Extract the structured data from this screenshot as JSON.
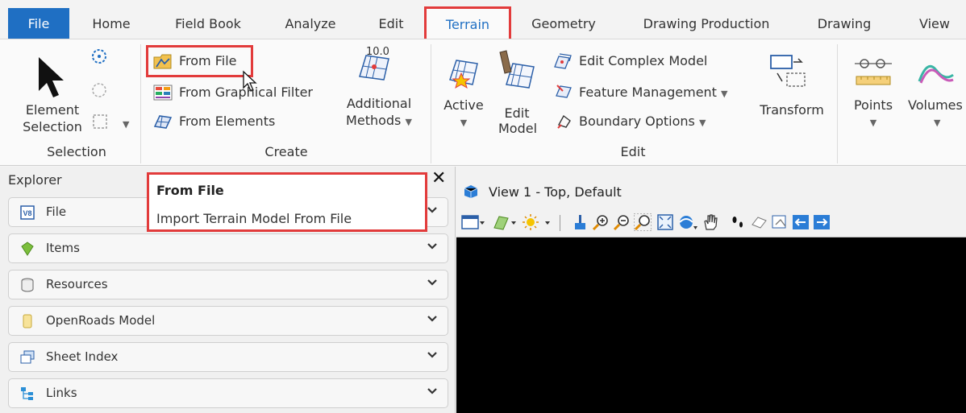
{
  "tabs": [
    {
      "label": "File"
    },
    {
      "label": "Home"
    },
    {
      "label": "Field Book"
    },
    {
      "label": "Analyze"
    },
    {
      "label": "Edit"
    },
    {
      "label": "Terrain"
    },
    {
      "label": "Geometry"
    },
    {
      "label": "Drawing Production"
    },
    {
      "label": "Drawing"
    },
    {
      "label": "View"
    }
  ],
  "ribbon": {
    "selection": {
      "element_selection_line1": "Element",
      "element_selection_line2": "Selection",
      "group_label": "Selection"
    },
    "create": {
      "from_file": "From File",
      "from_graphical_filter": "From Graphical Filter",
      "from_elements": "From Elements",
      "additional_methods_line1": "Additional",
      "additional_methods_line2": "Methods",
      "group_label": "Create",
      "badge": "10.0"
    },
    "edit": {
      "active": "Active",
      "edit_model_line1": "Edit",
      "edit_model_line2": "Model",
      "edit_complex_model": "Edit Complex Model",
      "feature_management": "Feature Management",
      "boundary_options": "Boundary Options",
      "transform": "Transform",
      "group_label": "Edit"
    },
    "geometry": {
      "points": "Points",
      "volumes": "Volumes"
    }
  },
  "tooltip": {
    "title": "From File",
    "description": "Import Terrain Model From File"
  },
  "explorer": {
    "title": "Explorer",
    "items": [
      {
        "label": "File"
      },
      {
        "label": "Items"
      },
      {
        "label": "Resources"
      },
      {
        "label": "OpenRoads Model"
      },
      {
        "label": "Sheet Index"
      },
      {
        "label": "Links"
      }
    ]
  },
  "view": {
    "title": "View 1 - Top, Default"
  },
  "colors": {
    "accent": "#1f6fc3",
    "highlight": "#e23b3b",
    "viewport": "#000000"
  }
}
